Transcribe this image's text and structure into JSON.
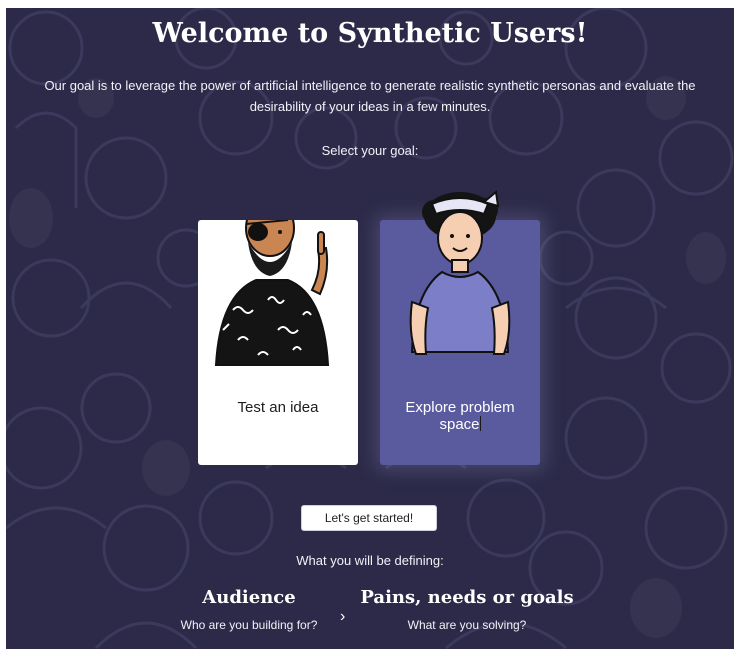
{
  "header": {
    "title": "Welcome to Synthetic Users!",
    "intro_line1": "Our goal is to leverage the power of artificial intelligence to generate realistic synthetic personas and evaluate the",
    "intro_line2": "desirability of your ideas in a few minutes.",
    "select_label": "Select your goal:"
  },
  "goals": [
    {
      "label": "Test an idea",
      "selected": false,
      "icon": "bearded-man-persona-illustration"
    },
    {
      "label_line1": "Explore problem",
      "label_line2": "space",
      "selected": true,
      "icon": "woman-with-bandana-persona-illustration"
    }
  ],
  "start_button": {
    "label": "Let's get started!"
  },
  "defining": {
    "label": "What you will be defining:",
    "steps": [
      {
        "title": "Audience",
        "subtitle": "Who are you building for?"
      },
      {
        "title": "Pains, needs or goals",
        "subtitle": "What are you solving?"
      }
    ],
    "arrow_icon": "chevron-right-icon"
  },
  "colors": {
    "background": "#2c2a48",
    "selected_card": "#5a5a9e",
    "card": "#ffffff"
  }
}
